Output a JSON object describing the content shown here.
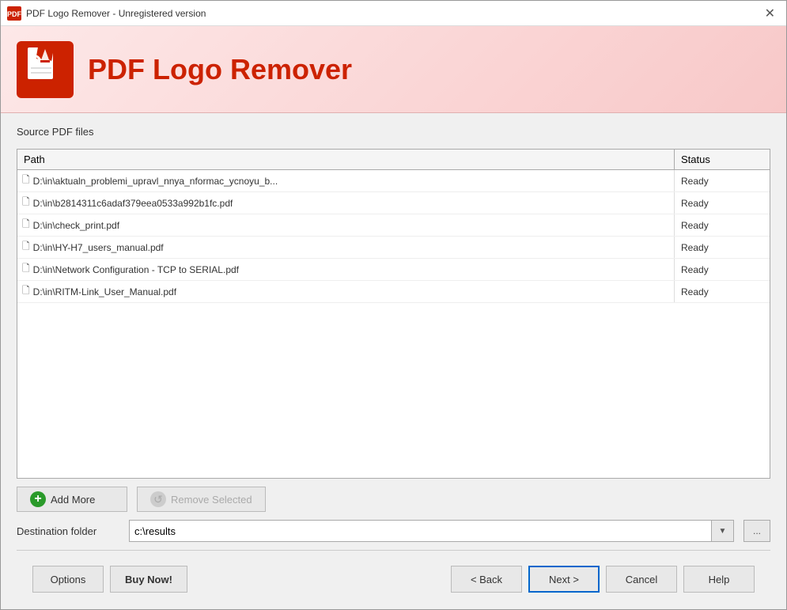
{
  "window": {
    "title": "PDF Logo Remover - Unregistered version",
    "close_label": "✕"
  },
  "header": {
    "app_name": "PDF Logo Remover",
    "logo_alt": "PDF Logo Remover logo"
  },
  "section": {
    "source_label": "Source PDF files"
  },
  "table": {
    "col_path": "Path",
    "col_status": "Status",
    "rows": [
      {
        "path": "D:\\in\\aktualn_problemi_upravl_nnya_nformac_ycnoyu_b...",
        "status": "Ready"
      },
      {
        "path": "D:\\in\\b2814311c6adaf379eea0533a992b1fc.pdf",
        "status": "Ready"
      },
      {
        "path": "D:\\in\\check_print.pdf",
        "status": "Ready"
      },
      {
        "path": "D:\\in\\HY-H7_users_manual.pdf",
        "status": "Ready"
      },
      {
        "path": "D:\\in\\Network Configuration - TCP to SERIAL.pdf",
        "status": "Ready"
      },
      {
        "path": "D:\\in\\RITM-Link_User_Manual.pdf",
        "status": "Ready"
      }
    ]
  },
  "buttons": {
    "add_more": "Add More",
    "remove_selected": "Remove Selected"
  },
  "destination": {
    "label": "Destination folder",
    "value": "c:\\results",
    "placeholder": "c:\\results",
    "browse_label": "..."
  },
  "bottom_buttons": {
    "options": "Options",
    "buy_now": "Buy Now!",
    "back": "< Back",
    "next": "Next >",
    "cancel": "Cancel",
    "help": "Help"
  }
}
